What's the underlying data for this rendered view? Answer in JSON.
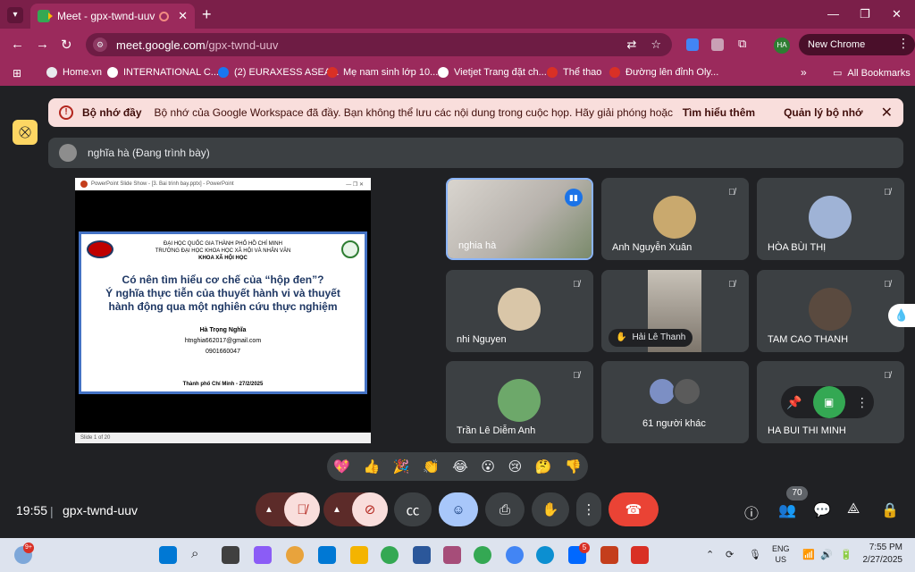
{
  "browser": {
    "tab_title": "Meet - gpx-twnd-uuv",
    "url_host": "meet.google.com",
    "url_path": "/gpx-twnd-uuv",
    "profile_initials": "HA",
    "new_chrome_label": "New Chrome available",
    "bookmarks": [
      {
        "label": "Home.vn",
        "color": "#e8eaed"
      },
      {
        "label": "INTERNATIONAL C...",
        "color": "#ffffff"
      },
      {
        "label": "(2) EURAXESS ASEA...",
        "color": "#1877f2"
      },
      {
        "label": "Mẹ nam sinh lớp 10...",
        "color": "#d93025"
      },
      {
        "label": "Vietjet Trang đặt ch...",
        "color": "#ffffff"
      },
      {
        "label": "Thể thao",
        "color": "#d93025"
      },
      {
        "label": "Đường lên đỉnh Oly...",
        "color": "#d93025"
      }
    ],
    "all_bookmarks_label": "All Bookmarks"
  },
  "banner": {
    "title": "Bộ nhớ đầy",
    "message": "Bộ nhớ của Google Workspace đã đầy. Bạn không thể lưu các nội dung trong cuộc họp. Hãy giải phóng hoặc mua thê...",
    "learn_more": "Tìm hiểu thêm",
    "manage": "Quản lý bộ nhớ"
  },
  "presenter_label": "nghĩa hà (Đang trình bày)",
  "slide": {
    "window_title": "PowerPoint Slide Show - [3. Bai trinh bay.pptx] - PowerPoint",
    "uni1": "ĐẠI HỌC QUỐC GIA THÀNH PHỐ HỒ CHÍ MINH",
    "uni2": "TRƯỜNG ĐẠI HỌC KHOA HỌC XÃ HỘI VÀ NHÂN VĂN",
    "uni3": "KHOA XÃ HỘI HỌC",
    "title1": "Có nên tìm hiểu cơ chế của “hộp đen”?",
    "title2": "Ý nghĩa thực tiễn của thuyết hành vi và thuyết",
    "title3": "hành động qua một nghiên cứu thực nghiệm",
    "author": "Hà Trọng Nghĩa",
    "email": "htnghia662017@gmail.com",
    "phone": "0901660047",
    "footer": "Thành phố Chí Minh - 27/2/2025",
    "status": "Slide 1 of 20"
  },
  "participants": [
    {
      "name": "nghia hà",
      "state": "speaking"
    },
    {
      "name": "Anh Nguyễn Xuân",
      "state": "muted"
    },
    {
      "name": "HÒA BÙI THỊ",
      "state": "muted"
    },
    {
      "name": "nhi Nguyen",
      "state": "muted"
    },
    {
      "name": "Hải Lê Thanh",
      "state": "hand-raised"
    },
    {
      "name": "TAM CAO THANH",
      "state": "muted"
    },
    {
      "name": "Trần Lê Diễm Anh",
      "state": "muted"
    },
    {
      "name": "61 người khác",
      "state": "others"
    },
    {
      "name": "HA BUI THI MINH",
      "state": "muted"
    }
  ],
  "reactions": [
    "💖",
    "👍",
    "🎉",
    "👏",
    "😂",
    "😮",
    "😢",
    "🤔",
    "👎"
  ],
  "meeting": {
    "time": "19:55",
    "code": "gpx-twnd-uuv",
    "participant_count": "70"
  },
  "taskbar": {
    "weather_badge": "9+",
    "zalo_badge": "5",
    "lang1": "ENG",
    "lang2": "US",
    "time": "7:55 PM",
    "date": "2/27/2025"
  }
}
